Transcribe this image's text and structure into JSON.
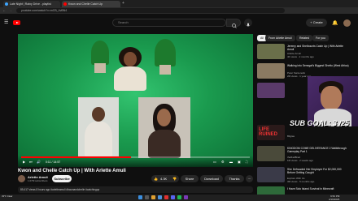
{
  "browser": {
    "tabs": [
      {
        "label": "Late Night | Rainy Drive - playlist",
        "color": "#3ea6ff",
        "active": false
      },
      {
        "label": "Kwon and Chelle Catch Up",
        "color": "#ff0000",
        "active": true
      }
    ],
    "url": "youtube.com/watch?v=mCB_4vBN4"
  },
  "youtube": {
    "search_placeholder": "Search",
    "create_label": "+ Create"
  },
  "video": {
    "time": "0:11 / 14:57",
    "progress": 0.48,
    "title": "Kwon and Chelle Catch Up | With Arlette Amuli"
  },
  "channel": {
    "name": "Arlette Amuli",
    "subs": "1.07M subscribers",
    "subscribe_label": "Subscribe"
  },
  "actions": {
    "likes": "4.3K",
    "share_label": "Share",
    "download_label": "Download",
    "thanks_label": "Thanks"
  },
  "description": "89,417 views  8 hours ago  #arletteamuli #kwonandchelle #catchingup",
  "chips": [
    "All",
    "From Arlette Amuli",
    "Related",
    "For you"
  ],
  "recommendations": [
    {
      "title": "Jeremy and Shelbounts Catch Up | With Arlette Amuli",
      "channel": "Arlette Amuli",
      "meta": "4K views · 2 months ago",
      "color": "#6a6f4a"
    },
    {
      "title": "Walking into Senegal's Biggest Ghetto (West Africa)",
      "channel": "Peter Santenello",
      "meta": "2M views · 1 year ago",
      "color": "#8a7a62"
    },
    {
      "title": "",
      "channel": "",
      "meta": "",
      "color": "#5a3a6a"
    },
    {
      "title": "KINGDOM COME DELIVERANCE 2 Walkthrough Gameplay Part 1",
      "channel": "theRadBrad",
      "meta": "1M views · 2 weeks ago",
      "color": "#4a4a3a"
    },
    {
      "title": "She Defrauded Her Employer For $2,000,000 Before Getting Caught",
      "channel": "Explore With Us",
      "meta": "3M views · 5 months ago",
      "color": "#3a3a48"
    },
    {
      "title": "I Have Solo Island Survival in Minecraft",
      "channel": "",
      "meta": "",
      "color": "#2e6a3a"
    }
  ],
  "overlay": {
    "sub_goal": "SUB GOAL: 3 /25",
    "rec3_title": "LIFE RUINED",
    "rec3_channel": "Bilgtas"
  },
  "taskbar": {
    "weather": "33°F Clear",
    "time": "9:52 PM",
    "date": "2/19/2025"
  }
}
